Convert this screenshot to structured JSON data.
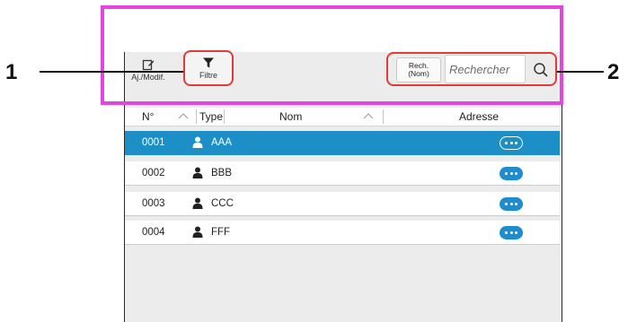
{
  "toolbar": {
    "edit_label": "Aj./Modif.",
    "filter_label": "Filtre",
    "search_type_line1": "Rech.",
    "search_type_line2": "(Nom)",
    "search_placeholder": "Rechercher"
  },
  "table": {
    "columns": [
      "N°",
      "Type",
      "Nom",
      "Adresse"
    ],
    "rows": [
      {
        "number": "0001",
        "name": "AAA",
        "selected": true
      },
      {
        "number": "0002",
        "name": "BBB",
        "selected": false
      },
      {
        "number": "0003",
        "name": "CCC",
        "selected": false
      },
      {
        "number": "0004",
        "name": "FFF",
        "selected": false
      }
    ]
  },
  "callouts": {
    "left_number": "1",
    "right_number": "2"
  },
  "colors": {
    "highlight": "#e245e0",
    "callout_box": "#e23a3a",
    "selected_row": "#1b8fc6",
    "more_button": "#1c8ed0"
  }
}
